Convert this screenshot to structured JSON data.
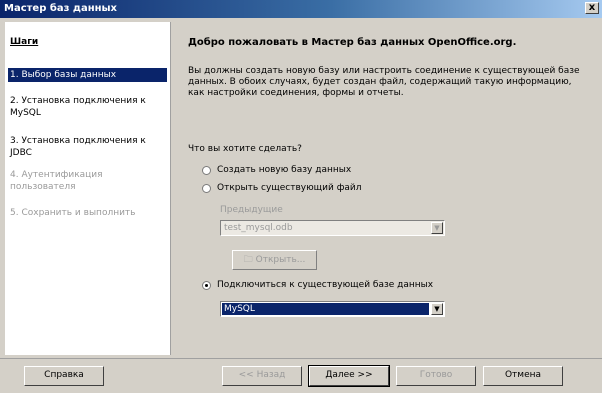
{
  "window": {
    "title": "Мастер баз данных",
    "close": "x"
  },
  "sidebar": {
    "title": "Шаги",
    "steps": [
      {
        "label": "1. Выбор базы данных",
        "state": "active"
      },
      {
        "label": "2. Установка подключения к MySQL",
        "state": "normal"
      },
      {
        "label": "3. Установка подключения к JDBC",
        "state": "normal"
      },
      {
        "label": "4. Аутентификация пользователя",
        "state": "disabled"
      },
      {
        "label": "5. Сохранить и выполнить",
        "state": "disabled"
      }
    ]
  },
  "main": {
    "heading": "Добро пожаловать в Мастер баз данных OpenOffice.org.",
    "description": "Вы должны создать новую базу или настроить соединение к существующей базе данных. В обоих случаях, будет создан файл, содержащий такую информацию, как настройки соединения, формы и отчеты.",
    "question": "Что вы хотите сделать?",
    "options": {
      "create_new": {
        "label": "Создать новую базу данных",
        "checked": false
      },
      "open_existing": {
        "label": "Открыть существующий файл",
        "checked": false
      },
      "connect_existing": {
        "label": "Подключиться к существующей базе данных",
        "checked": true
      }
    },
    "previous_label": "Предыдущие",
    "previous_value": "test_mysql.odb",
    "open_button": "Открыть...",
    "database_type": "MySQL"
  },
  "footer": {
    "help": "Справка",
    "back": "<< Назад",
    "next": "Далее >>",
    "finish": "Готово",
    "cancel": "Отмена"
  },
  "colors": {
    "selection": "#0a246a",
    "disabled_text": "#9a9a9a",
    "dialog_bg": "#d4d0c8"
  }
}
